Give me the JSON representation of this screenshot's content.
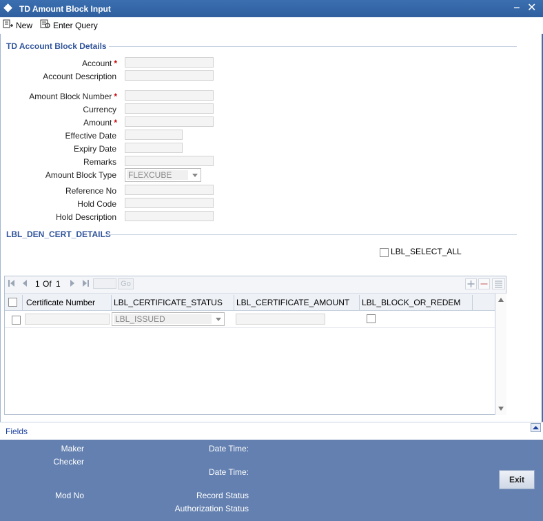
{
  "window": {
    "title": "TD Amount Block Input",
    "minimize": "‒",
    "close": "✕"
  },
  "toolbar": {
    "new_label": "New",
    "enter_query_label": "Enter Query"
  },
  "section1": {
    "title": "TD Account Block Details",
    "fields": {
      "account": {
        "label": "Account",
        "required": "*",
        "value": ""
      },
      "account_description": {
        "label": "Account Description",
        "value": ""
      },
      "amount_block_number": {
        "label": "Amount Block Number",
        "required": "*",
        "value": ""
      },
      "currency": {
        "label": "Currency",
        "value": ""
      },
      "amount": {
        "label": "Amount",
        "required": "*",
        "value": ""
      },
      "effective_date": {
        "label": "Effective Date",
        "value": ""
      },
      "expiry_date": {
        "label": "Expiry Date",
        "value": ""
      },
      "remarks": {
        "label": "Remarks",
        "value": ""
      },
      "amount_block_type": {
        "label": "Amount Block Type",
        "value": "FLEXCUBE"
      },
      "reference_no": {
        "label": "Reference No",
        "value": ""
      },
      "hold_code": {
        "label": "Hold Code",
        "value": ""
      },
      "hold_description": {
        "label": "Hold Description",
        "value": ""
      }
    }
  },
  "section2": {
    "title": "LBL_DEN_CERT_DETAILS",
    "select_all_label": "LBL_SELECT_ALL"
  },
  "grid": {
    "pager": {
      "current": "1",
      "of_label": "Of",
      "total": "1",
      "go_label": "Go"
    },
    "columns": [
      "Certificate Number",
      "LBL_CERTIFICATE_STATUS",
      "LBL_CERTIFICATE_AMOUNT",
      "LBL_BLOCK_OR_REDEM"
    ],
    "rows": [
      {
        "certificate_number": "",
        "status": "LBL_ISSUED",
        "amount": "",
        "block_or_redem": false
      }
    ]
  },
  "footer": {
    "fields_label": "Fields",
    "maker_label": "Maker",
    "checker_label": "Checker",
    "date_time_label_1": "Date Time:",
    "date_time_label_2": "Date Time:",
    "mod_no_label": "Mod No",
    "record_status_label": "Record Status",
    "authorization_status_label": "Authorization Status",
    "exit_label": "Exit"
  },
  "colors": {
    "title_bar": "#3b6fb0",
    "section_title": "#31559b",
    "bottom_panel": "#6380b0",
    "required": "#cc0000"
  }
}
